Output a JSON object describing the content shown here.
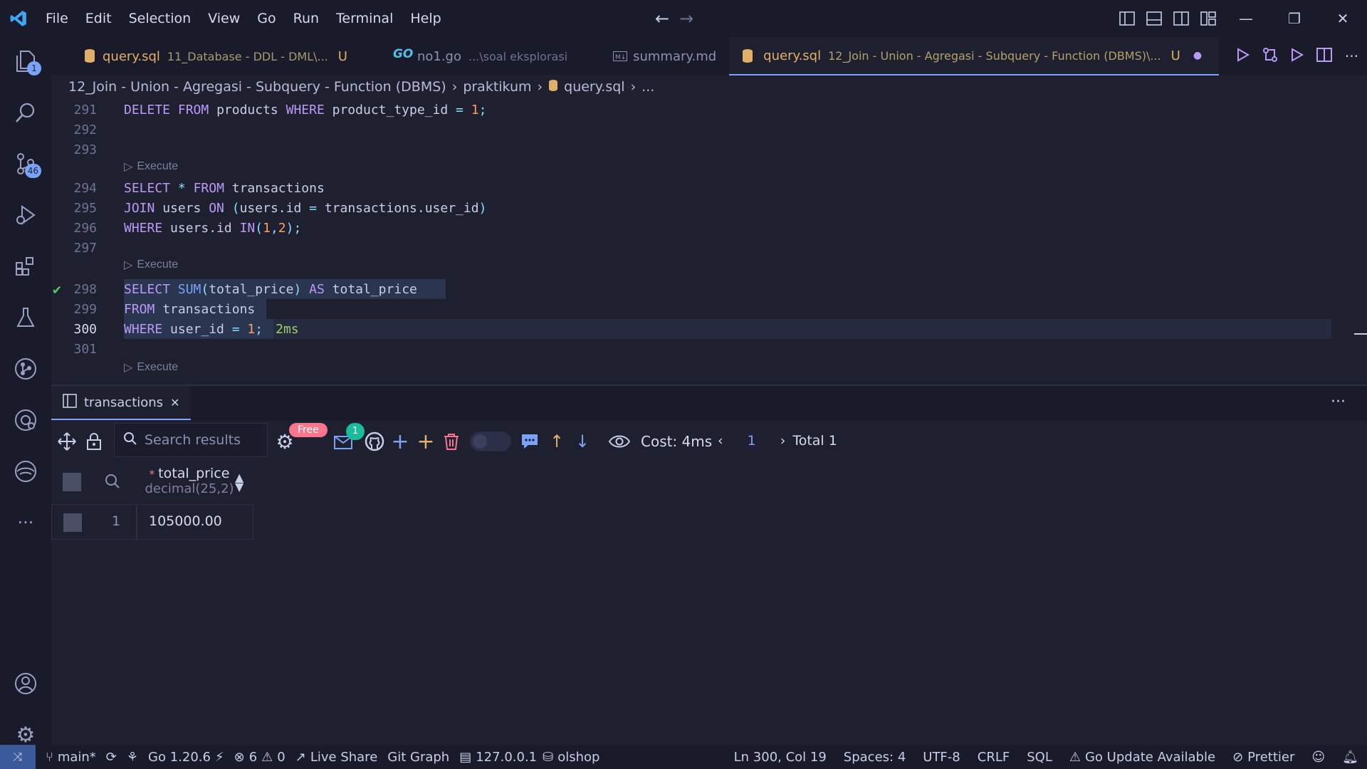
{
  "menu": {
    "items": [
      "File",
      "Edit",
      "Selection",
      "View",
      "Go",
      "Run",
      "Terminal",
      "Help"
    ]
  },
  "tabs": [
    {
      "name": "query.sql",
      "sub": "11_Database - DDL - DML\\...",
      "status": "U",
      "icon": "database-icon"
    },
    {
      "name": "no1.go",
      "sub": "...\\soal eksplorasi",
      "status": "",
      "icon": "go-icon"
    },
    {
      "name": "summary.md",
      "sub": "",
      "status": "",
      "icon": "markdown-icon"
    },
    {
      "name": "query.sql",
      "sub": "12_Join - Union - Agregasi - Subquery - Function (DBMS)\\...",
      "status": "U",
      "icon": "database-icon"
    }
  ],
  "breadcrumb": {
    "folder": "12_Join - Union - Agregasi - Subquery - Function (DBMS)",
    "sub": "praktikum",
    "file": "query.sql",
    "more": "..."
  },
  "editor": {
    "lines": [
      {
        "n": "291",
        "code": "DELETE FROM products WHERE product_type_id = 1;"
      },
      {
        "n": "292",
        "code": ""
      },
      {
        "n": "293",
        "code": ""
      },
      {
        "n": "294",
        "code": "SELECT * FROM transactions"
      },
      {
        "n": "295",
        "code": "JOIN users ON (users.id = transactions.user_id)"
      },
      {
        "n": "296",
        "code": "WHERE users.id IN(1,2);"
      },
      {
        "n": "297",
        "code": ""
      },
      {
        "n": "298",
        "code": "SELECT SUM(total_price) AS total_price"
      },
      {
        "n": "299",
        "code": "FROM transactions"
      },
      {
        "n": "300",
        "code": "WHERE user_id = 1;"
      },
      {
        "n": "301",
        "code": ""
      }
    ],
    "codelens": "Execute",
    "timing": "2ms"
  },
  "panel": {
    "tab_label": "transactions",
    "more": "···"
  },
  "toolbar": {
    "search_placeholder": "Search results",
    "free_badge": "Free",
    "notif_count": "1",
    "cost": "Cost: 4ms",
    "page": "1",
    "total": "Total 1"
  },
  "grid": {
    "column_name": "total_price",
    "column_type": "decimal(25,2)",
    "required_mark": "*",
    "rows": [
      {
        "index": "1",
        "value": "105000.00"
      }
    ]
  },
  "activity": {
    "explorer_badge": "1",
    "scm_badge": "46"
  },
  "status": {
    "branch": "main*",
    "go_version": "Go 1.20.6",
    "errors": "6",
    "warnings": "0",
    "live_share": "Live Share",
    "git_graph": "Git Graph",
    "db_host": "127.0.0.1",
    "db_name": "olshop",
    "position": "Ln 300, Col 19",
    "spaces": "Spaces: 4",
    "encoding": "UTF-8",
    "eol": "CRLF",
    "language": "SQL",
    "go_update": "Go Update Available",
    "prettier": "Prettier"
  },
  "colors": {
    "accent": "#7aa2f7",
    "keyword": "#bb9af7",
    "number": "#ff9e64",
    "string_green": "#9ece6a",
    "modified": "#e0af68"
  }
}
